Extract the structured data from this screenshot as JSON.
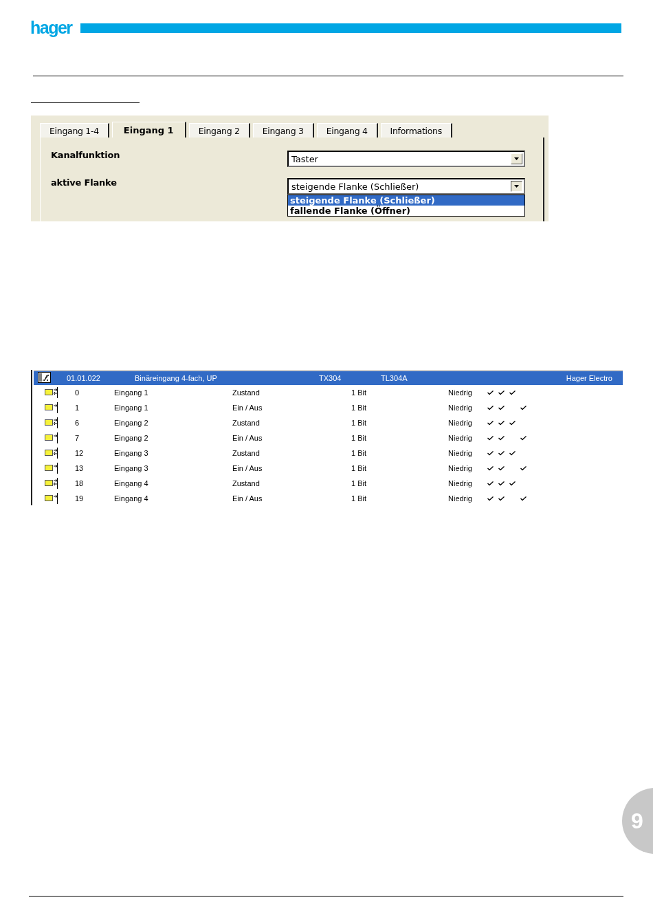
{
  "header": {
    "logo": "hager"
  },
  "dialog": {
    "tabs": [
      {
        "label": "Eingang 1-4",
        "selected": false
      },
      {
        "label": "Eingang 1",
        "selected": true
      },
      {
        "label": "Eingang 2",
        "selected": false
      },
      {
        "label": "Eingang 3",
        "selected": false
      },
      {
        "label": "Eingang 4",
        "selected": false
      },
      {
        "label": "Informations",
        "selected": false
      }
    ],
    "params": [
      {
        "label": "Kanalfunktion",
        "value": "Taster",
        "expanded": false
      },
      {
        "label": "aktive Flanke",
        "value": "steigende Flanke (Schließer)",
        "expanded": true,
        "options": [
          {
            "label": "steigende Flanke (Schließer)",
            "selected": true
          },
          {
            "label": "fallende Flanke (Öffner)",
            "selected": false
          }
        ]
      }
    ]
  },
  "device": {
    "address": "01.01.022",
    "name": "Binäreingang 4-fach, UP",
    "product": "TX304",
    "application": "TL304A",
    "manufacturer": "Hager Electro",
    "selected": true,
    "objects": [
      {
        "kind": "status",
        "number": "0",
        "name": "Eingang 1",
        "function": "Zustand",
        "length": "1 Bit",
        "priority": "Niedrig",
        "flags": [
          true,
          true,
          true,
          false
        ]
      },
      {
        "kind": "switch",
        "number": "1",
        "name": "Eingang 1",
        "function": "Ein / Aus",
        "length": "1 Bit",
        "priority": "Niedrig",
        "flags": [
          true,
          true,
          false,
          true
        ]
      },
      {
        "kind": "status",
        "number": "6",
        "name": "Eingang 2",
        "function": "Zustand",
        "length": "1 Bit",
        "priority": "Niedrig",
        "flags": [
          true,
          true,
          true,
          false
        ]
      },
      {
        "kind": "switch",
        "number": "7",
        "name": "Eingang 2",
        "function": "Ein / Aus",
        "length": "1 Bit",
        "priority": "Niedrig",
        "flags": [
          true,
          true,
          false,
          true
        ]
      },
      {
        "kind": "status",
        "number": "12",
        "name": "Eingang 3",
        "function": "Zustand",
        "length": "1 Bit",
        "priority": "Niedrig",
        "flags": [
          true,
          true,
          true,
          false
        ]
      },
      {
        "kind": "switch",
        "number": "13",
        "name": "Eingang 3",
        "function": "Ein / Aus",
        "length": "1 Bit",
        "priority": "Niedrig",
        "flags": [
          true,
          true,
          false,
          true
        ]
      },
      {
        "kind": "status",
        "number": "18",
        "name": "Eingang 4",
        "function": "Zustand",
        "length": "1 Bit",
        "priority": "Niedrig",
        "flags": [
          true,
          true,
          true,
          false
        ]
      },
      {
        "kind": "switch",
        "number": "19",
        "name": "Eingang 4",
        "function": "Ein / Aus",
        "length": "1 Bit",
        "priority": "Niedrig",
        "flags": [
          true,
          true,
          false,
          true
        ]
      }
    ]
  },
  "page_number": "9"
}
